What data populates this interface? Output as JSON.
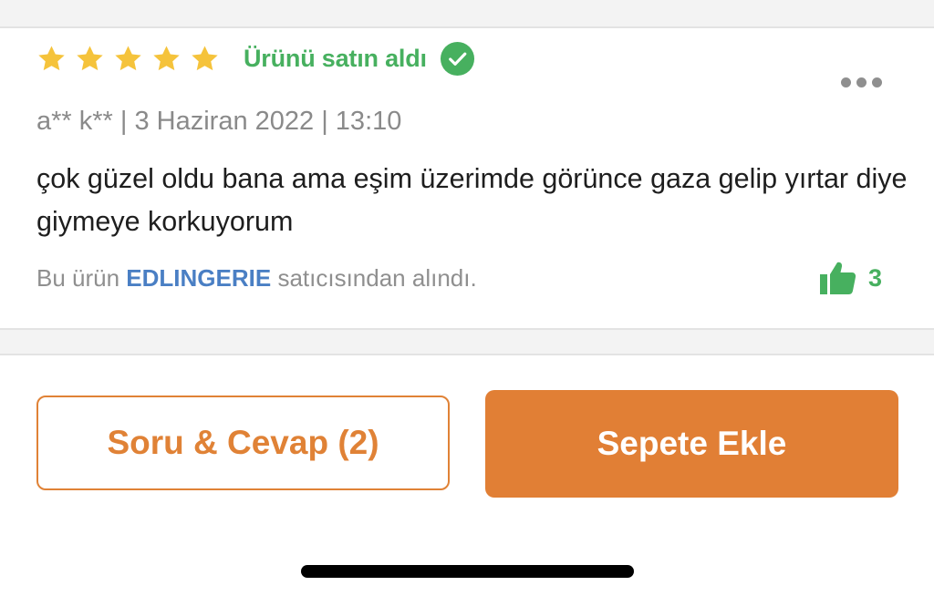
{
  "colors": {
    "accent_orange": "#e17f35",
    "verified_green": "#47b05f",
    "seller_blue": "#4a7fc4",
    "star_yellow": "#f5c33b"
  },
  "review": {
    "rating": 5,
    "rating_max": 5,
    "verified_label": "Ürünü satın aldı",
    "meta": "a** k** | 3 Haziran 2022 | 13:10",
    "text": "çok güzel oldu bana ama eşim üzerimde görünce gaza gelip yırtar diye giymeye korkuyorum",
    "seller_prefix": "Bu ürün ",
    "seller_name": "EDLINGERIE",
    "seller_suffix": " satıcısından alındı.",
    "likes": "3"
  },
  "icons": {
    "star": "star-icon",
    "verified": "check-circle-icon",
    "more": "more-dots-icon",
    "like": "thumbs-up-icon"
  },
  "actions": {
    "qa_label": "Soru & Cevap (2)",
    "cart_label": "Sepete Ekle"
  }
}
